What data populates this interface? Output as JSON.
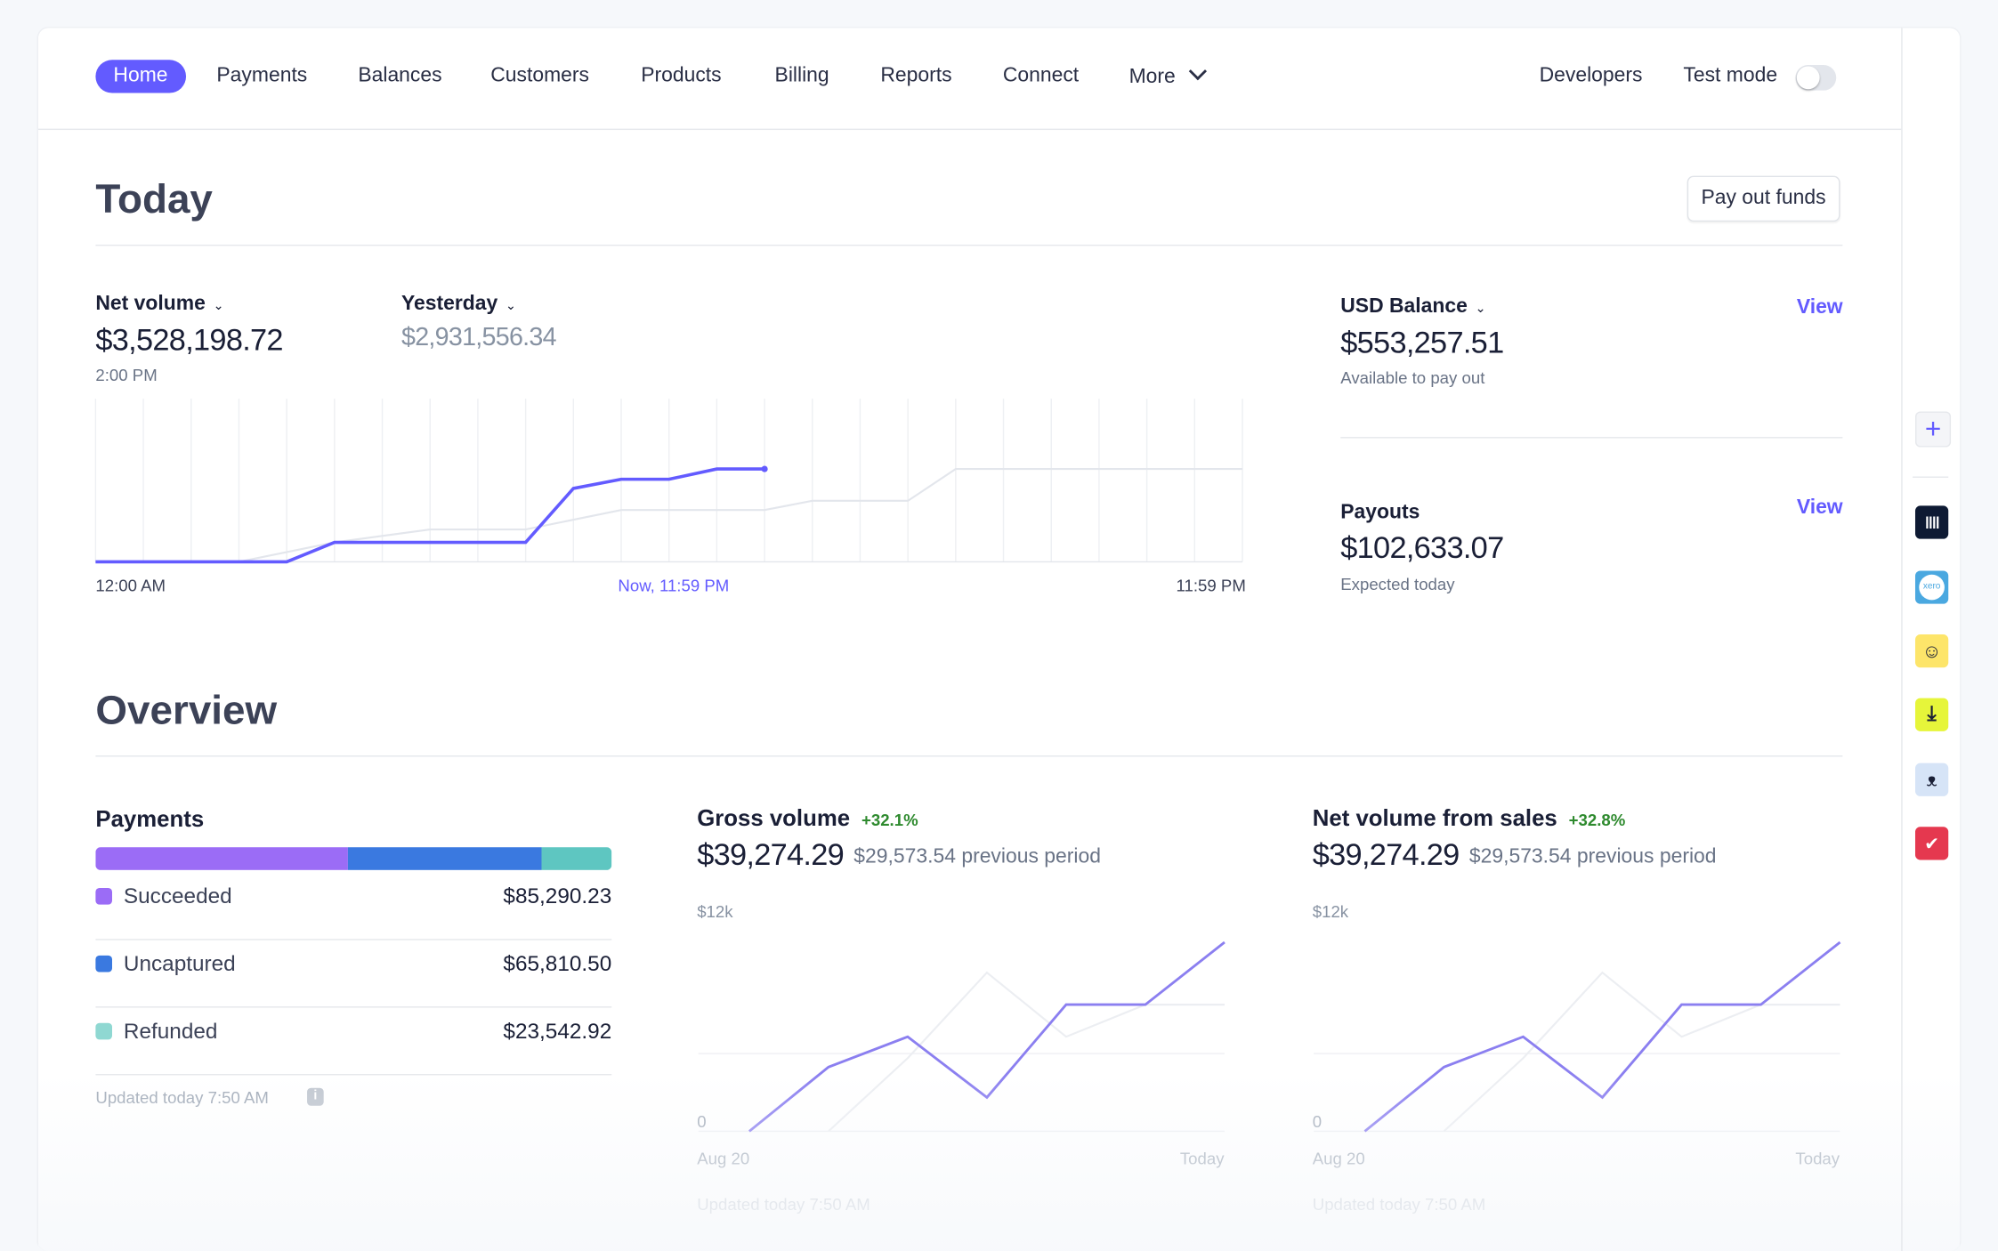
{
  "nav": {
    "items": [
      "Home",
      "Payments",
      "Balances",
      "Customers",
      "Products",
      "Billing",
      "Reports",
      "Connect",
      "More"
    ],
    "active": "Home",
    "developers": "Developers",
    "test_mode": "Test mode",
    "test_mode_on": false
  },
  "today": {
    "title": "Today",
    "pay_out_button": "Pay out funds",
    "net_volume": {
      "label": "Net volume",
      "value": "$3,528,198.72",
      "time": "2:00 PM"
    },
    "compare": {
      "label": "Yesterday",
      "value": "$2,931,556.34"
    },
    "usd_balance": {
      "label": "USD Balance",
      "value": "$553,257.51",
      "sub": "Available to pay out",
      "link": "View"
    },
    "payouts": {
      "label": "Payouts",
      "value": "$102,633.07",
      "sub": "Expected today",
      "link": "View"
    }
  },
  "overview": {
    "title": "Overview",
    "payments": {
      "title": "Payments",
      "rows": [
        {
          "name": "Succeeded",
          "value": "$85,290.23",
          "amount": 85290.23,
          "color": "#9b6cf6"
        },
        {
          "name": "Uncaptured",
          "value": "$65,810.50",
          "amount": 65810.5,
          "color": "#3a79e0"
        },
        {
          "name": "Refunded",
          "value": "$23,542.92",
          "amount": 23542.92,
          "color": "#5ec6c1"
        }
      ],
      "updated": "Updated today 7:50 AM"
    },
    "gross": {
      "title": "Gross volume",
      "change": "+32.1%",
      "value": "$39,274.29",
      "previous": "$29,573.54 previous period",
      "updated": "Updated today 7:50 AM"
    },
    "net_sales": {
      "title": "Net volume from sales",
      "change": "+32.8%",
      "value": "$39,274.29",
      "previous": "$29,573.54 previous period",
      "updated": "Updated today 7:50 AM"
    }
  },
  "rail": {
    "icons": [
      "plus-icon",
      "intercom-icon",
      "xero-icon",
      "mailchimp-icon",
      "download-icon",
      "owl-icon",
      "chat-check-icon"
    ]
  },
  "colors": {
    "accent": "#635bff",
    "positive": "#2e8a2e"
  },
  "chart_data": [
    {
      "type": "line",
      "title": "Net volume",
      "xlabel": "",
      "ylabel": "",
      "x_tick_labels": [
        "12:00 AM",
        "Now, 11:59 PM",
        "11:59 PM"
      ],
      "x_hours": [
        0,
        4,
        5,
        9,
        10,
        11,
        12,
        13,
        14
      ],
      "xlim": [
        0,
        24
      ],
      "ylim_musd": [
        0,
        6.2
      ],
      "grid": "vertical",
      "series": [
        {
          "name": "Net volume",
          "color": "#635bff",
          "x": [
            0,
            4,
            5,
            9,
            10,
            11,
            12,
            13,
            14
          ],
          "values": [
            0,
            0,
            0.74,
            0.74,
            2.79,
            3.14,
            3.14,
            3.53,
            3.53
          ]
        },
        {
          "name": "Yesterday",
          "color": "#e3e6ec",
          "x": [
            0,
            3,
            5,
            7,
            9,
            11,
            14,
            15,
            17,
            18,
            24
          ],
          "values": [
            0,
            0,
            0.74,
            1.23,
            1.23,
            1.97,
            1.97,
            2.32,
            2.32,
            3.53,
            3.53
          ]
        }
      ]
    },
    {
      "type": "line",
      "title": "Gross volume",
      "y_tick_labels": [
        "$12k",
        "0"
      ],
      "x_tick_labels": [
        "Aug 20",
        "Today"
      ],
      "ylim": [
        0,
        12000
      ],
      "series": [
        {
          "color": "#8b7ff0",
          "values": [
            0,
            3600,
            5300,
            1900,
            7100,
            7100,
            10600
          ]
        },
        {
          "color": "#eceef2",
          "values": [
            null,
            0,
            4100,
            8900,
            5300,
            7100,
            7100
          ]
        }
      ]
    },
    {
      "type": "line",
      "title": "Net volume from sales",
      "y_tick_labels": [
        "$12k",
        "0"
      ],
      "x_tick_labels": [
        "Aug 20",
        "Today"
      ],
      "ylim": [
        0,
        12000
      ],
      "series": [
        {
          "color": "#8b7ff0",
          "values": [
            0,
            3600,
            5300,
            1900,
            7100,
            7100,
            10600
          ]
        },
        {
          "color": "#eceef2",
          "values": [
            null,
            0,
            4100,
            8900,
            5300,
            7100,
            7100
          ]
        }
      ]
    }
  ]
}
